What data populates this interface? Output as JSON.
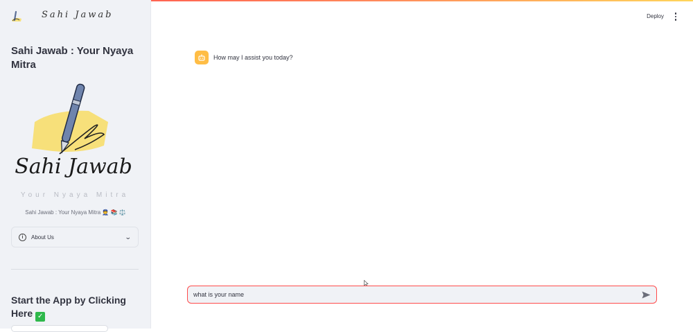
{
  "sidebar": {
    "brand_text": "Sahi Jawab",
    "title": "Sahi Jawab : Your Nyaya Mitra",
    "logo": {
      "main_text": "Sahi Jawab",
      "tagline": "Your Nyaya Mitra",
      "accent_color": "#f7e07a"
    },
    "caption": "Sahi Jawab : Your Nyaya Mitra 👮 📚 ⚖️",
    "expander_label": "About Us",
    "start_heading": "Start the App by Clicking Here"
  },
  "header": {
    "deploy_label": "Deploy",
    "menu_icon": "kebab-menu-icon"
  },
  "chat": {
    "messages": [
      {
        "role": "assistant",
        "avatar_icon": "bot-icon",
        "text": "How may I assist you today?"
      }
    ],
    "input_value": "what is your name",
    "send_icon": "send-icon"
  },
  "colors": {
    "accent": "#ff4b4b",
    "sidebar_bg": "#f0f2f6",
    "avatar_bg": "#ffbd45",
    "check_green": "#2eb84b"
  }
}
